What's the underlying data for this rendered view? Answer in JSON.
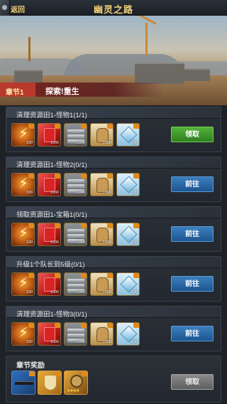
{
  "header": {
    "back_label": "返回",
    "title": "幽灵之路"
  },
  "chapter": {
    "tag": "章节1",
    "name": "探索!重生"
  },
  "resource_icons": [
    "energy-icon",
    "fuel-can-icon",
    "steel-bars-icon",
    "food-sack-icon",
    "crystal-icon"
  ],
  "tasks": [
    {
      "title": "清理资源田1-怪物1(1/1)",
      "amounts": [
        "100",
        "1000",
        "1000",
        "1000",
        "100"
      ],
      "button": "领取",
      "state": "claim"
    },
    {
      "title": "清理资源田1-怪物2(0/1)",
      "amounts": [
        "100",
        "1000",
        "1000",
        "1000",
        "100"
      ],
      "button": "前往",
      "state": "go"
    },
    {
      "title": "领取资源田1-宝箱1(0/1)",
      "amounts": [
        "100",
        "1000",
        "1000",
        "1000",
        "100"
      ],
      "button": "前往",
      "state": "go"
    },
    {
      "title": "升级1个队长到5级(0/1)",
      "amounts": [
        "100",
        "1000",
        "1000",
        "1000",
        "100"
      ],
      "button": "前往",
      "state": "go"
    },
    {
      "title": "清理资源田1-怪物3(0/1)",
      "amounts": [
        "100",
        "1000",
        "1000",
        "1000",
        "100"
      ],
      "button": "前往",
      "state": "go"
    }
  ],
  "chapter_reward": {
    "title": "章节奖励",
    "items": [
      "rifle-icon",
      "shield-icon",
      "emblem-icon"
    ],
    "stars": "★★★★",
    "button": "领取",
    "state": "disabled"
  },
  "colors": {
    "title_gold": "#f5d27a",
    "claim_green": "#54b23a",
    "go_blue": "#3b7ebe",
    "disabled_gray": "#8a8a8a",
    "chapter_red": "#b83a2c"
  }
}
